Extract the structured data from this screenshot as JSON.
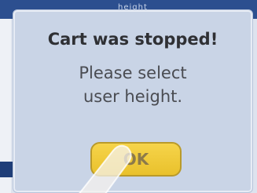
{
  "background": {
    "header_text": "height"
  },
  "dialog": {
    "title": "Cart was stopped!",
    "message_line1": "Please select",
    "message_line2": "user height.",
    "ok_label": "OK"
  },
  "colors": {
    "dialog_bg": "#c9d4e6",
    "button": "#f0cd3a",
    "title_text": "#2f3034"
  }
}
